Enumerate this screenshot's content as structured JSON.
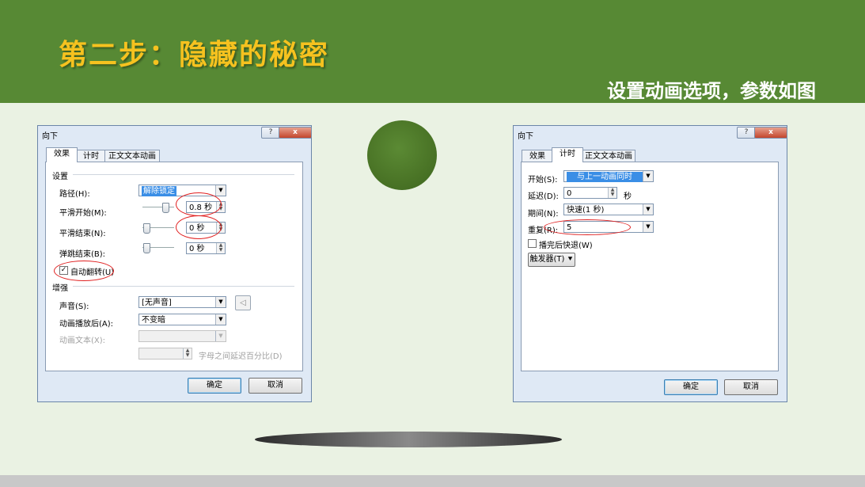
{
  "slide": {
    "title": "第二步：隐藏的秘密",
    "subtitle": "设置动画选项，参数如图"
  },
  "colors": {
    "header_bg": "#578934",
    "title_text": "#f6c21f",
    "body_bg": "#eaf2e3",
    "annotation_red": "#e02020"
  },
  "dialog_effect": {
    "title": "向下",
    "help_label": "?",
    "close_label": "x",
    "tabs": [
      "效果",
      "计时",
      "正文文本动画"
    ],
    "settings_header": "设置",
    "path_label": "路径(H):",
    "path_value": "解除锁定",
    "smooth_start_label": "平滑开始(M):",
    "smooth_start_value": "0.8 秒",
    "smooth_end_label": "平滑结束(N):",
    "smooth_end_value": "0 秒",
    "bounce_end_label": "弹跳结束(B):",
    "bounce_end_value": "0 秒",
    "auto_reverse_label": "自动翻转(U)",
    "auto_reverse_checked": "✓",
    "enhance_header": "增强",
    "sound_label": "声音(S):",
    "sound_value": "[无声音]",
    "after_anim_label": "动画播放后(A):",
    "after_anim_value": "不变暗",
    "anim_text_label": "动画文本(X):",
    "anim_text_value": "",
    "letter_delay_label": "字母之间延迟百分比(D)",
    "ok_label": "确定",
    "cancel_label": "取消"
  },
  "dialog_timing": {
    "title": "向下",
    "help_label": "?",
    "close_label": "x",
    "tabs": [
      "效果",
      "计时",
      "正文文本动画"
    ],
    "start_label": "开始(S):",
    "start_value": "与上一动画同时",
    "delay_label": "延迟(D):",
    "delay_value": "0",
    "delay_unit": "秒",
    "period_label": "期间(N):",
    "period_value": "快速(1 秒)",
    "repeat_label": "重复(R):",
    "repeat_value": "5",
    "rewind_label": "播完后快退(W)",
    "rewind_checked": "",
    "trigger_label": "触发器(T) ⯆",
    "ok_label": "确定",
    "cancel_label": "取消"
  }
}
